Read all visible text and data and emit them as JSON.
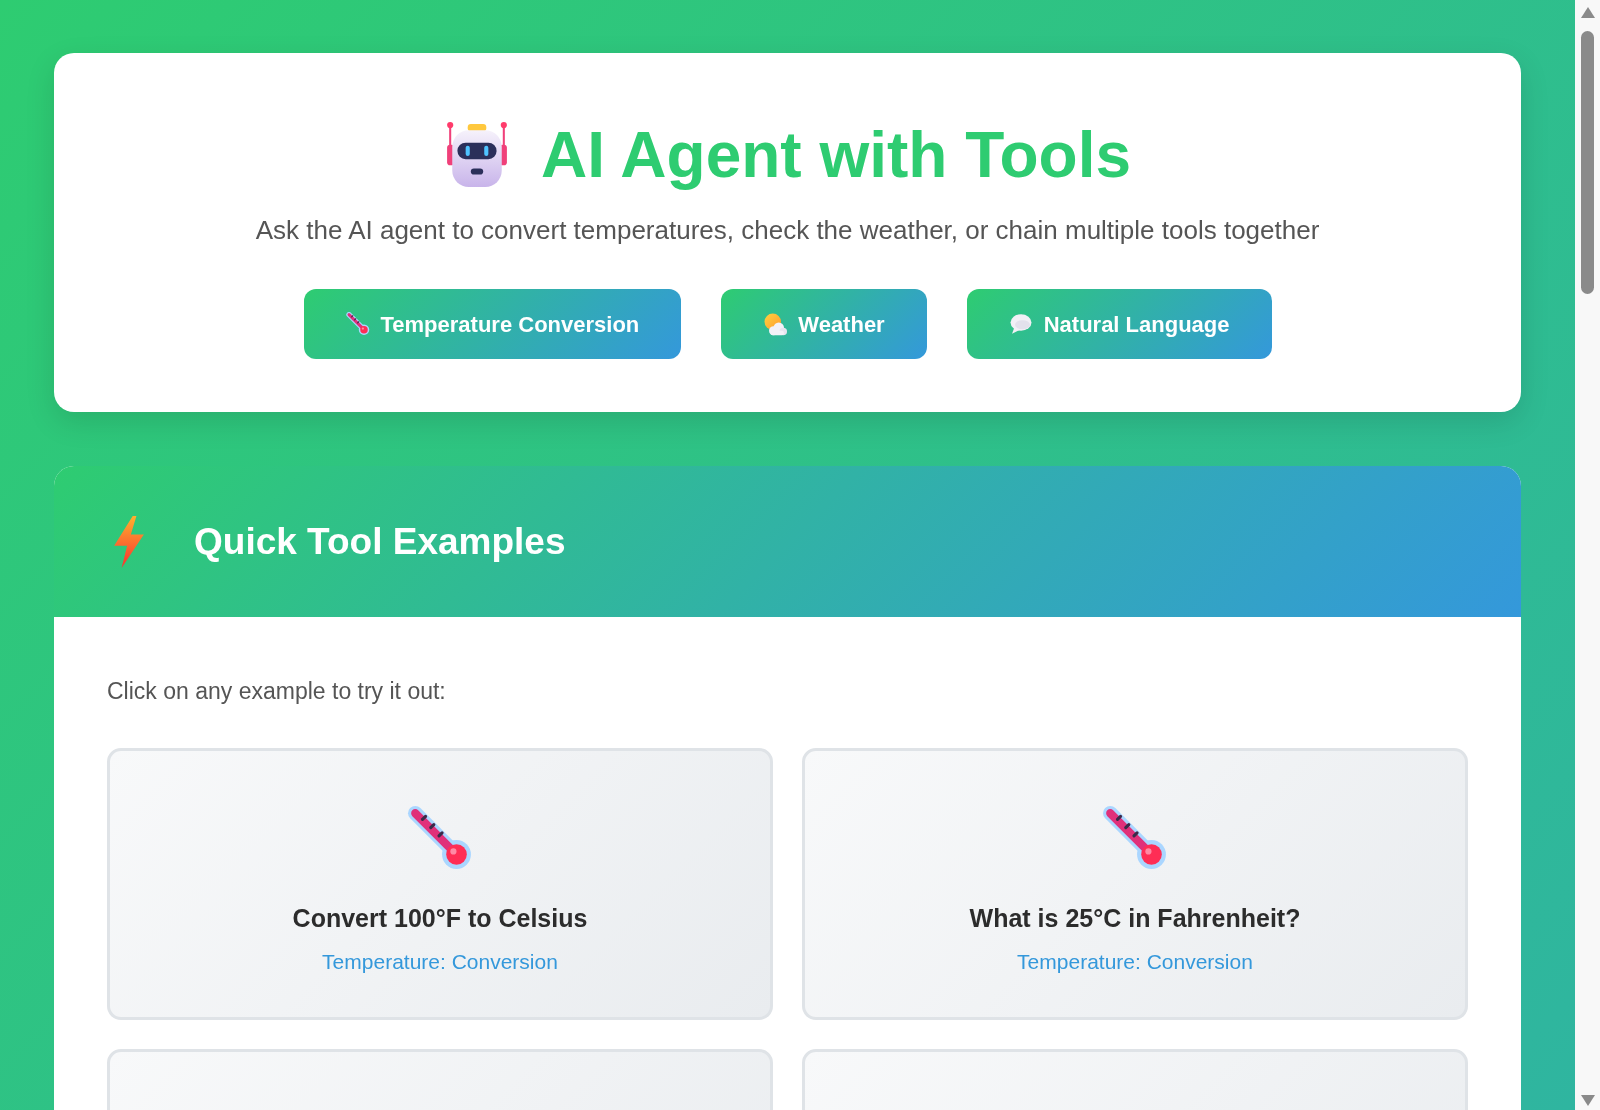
{
  "header": {
    "title": "AI Agent with Tools",
    "subtitle": "Ask the AI agent to convert temperatures, check the weather, or chain multiple tools together",
    "buttons": [
      {
        "kind": "temperature",
        "label": "Temperature Conversion"
      },
      {
        "kind": "weather",
        "label": "Weather"
      },
      {
        "kind": "chat",
        "label": "Natural Language"
      }
    ]
  },
  "examples": {
    "title": "Quick Tool Examples",
    "instruction": "Click on any example to try it out:",
    "cards": [
      {
        "kind": "temperature",
        "query": "Convert 100°F to Celsius",
        "tool": "Temperature: Conversion"
      },
      {
        "kind": "temperature",
        "query": "What is 25°C in Fahrenheit?",
        "tool": "Temperature: Conversion"
      },
      {
        "kind": "cut_off"
      },
      {
        "kind": "cut_off"
      }
    ]
  }
}
